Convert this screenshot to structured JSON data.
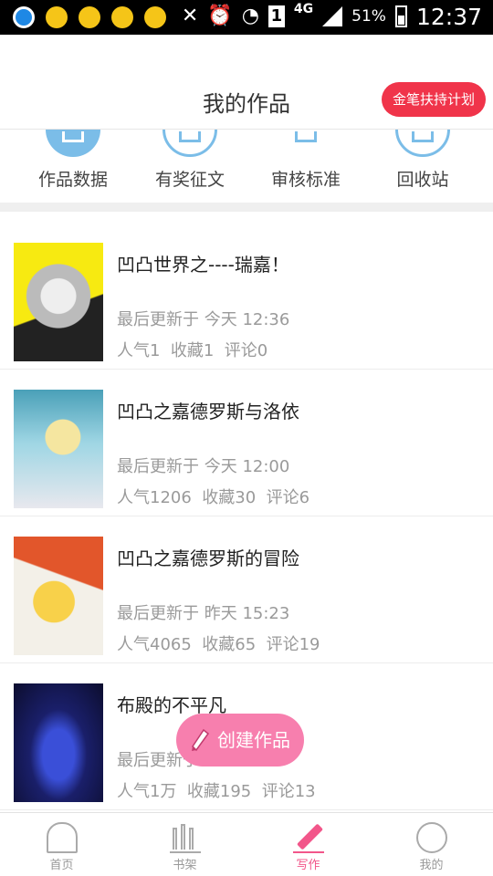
{
  "status_bar": {
    "network": "4G",
    "battery_percent": "51%",
    "time": "12:37",
    "sim_slot": "1",
    "icons": [
      "qq-icon",
      "bulb-icon",
      "bulb-icon",
      "bulb-icon",
      "bulb-icon",
      "mute-icon",
      "alarm-icon",
      "wifi-icon",
      "sim-icon",
      "signal-icon",
      "battery-icon"
    ]
  },
  "header": {
    "title": "我的作品",
    "program_button": "金笔扶持计划"
  },
  "quick_actions": [
    {
      "label": "作品数据",
      "icon": "data-icon"
    },
    {
      "label": "有奖征文",
      "icon": "contest-icon"
    },
    {
      "label": "审核标准",
      "icon": "review-icon"
    },
    {
      "label": "回收站",
      "icon": "trash-icon"
    }
  ],
  "works": [
    {
      "title": "凹凸世界之----瑞嘉！",
      "updated": "最后更新于 今天 12:36",
      "stats": "人气1  收藏1  评论0"
    },
    {
      "title": "凹凸之嘉德罗斯与洛依",
      "updated": "最后更新于 今天 12:00",
      "stats": "人气1206  收藏30  评论6"
    },
    {
      "title": "凹凸之嘉德罗斯的冒险",
      "updated": "最后更新于 昨天 15:23",
      "stats": "人气4065  收藏65  评论19"
    },
    {
      "title": "布殿的不平凡",
      "updated": "最后更新于",
      "stats": "人气1万  收藏195  评论13"
    }
  ],
  "create_button": {
    "label": "创建作品",
    "icon": "pencil-icon"
  },
  "tabs": [
    {
      "label": "首页",
      "icon": "home-icon"
    },
    {
      "label": "书架",
      "icon": "bookshelf-icon"
    },
    {
      "label": "写作",
      "icon": "write-icon",
      "active": true
    },
    {
      "label": "我的",
      "icon": "profile-icon"
    }
  ],
  "colors": {
    "accent_pink": "#f2568a",
    "program_red": "#f0344a",
    "icon_blue": "#7bbde8",
    "fab_pink": "#f77fae"
  }
}
